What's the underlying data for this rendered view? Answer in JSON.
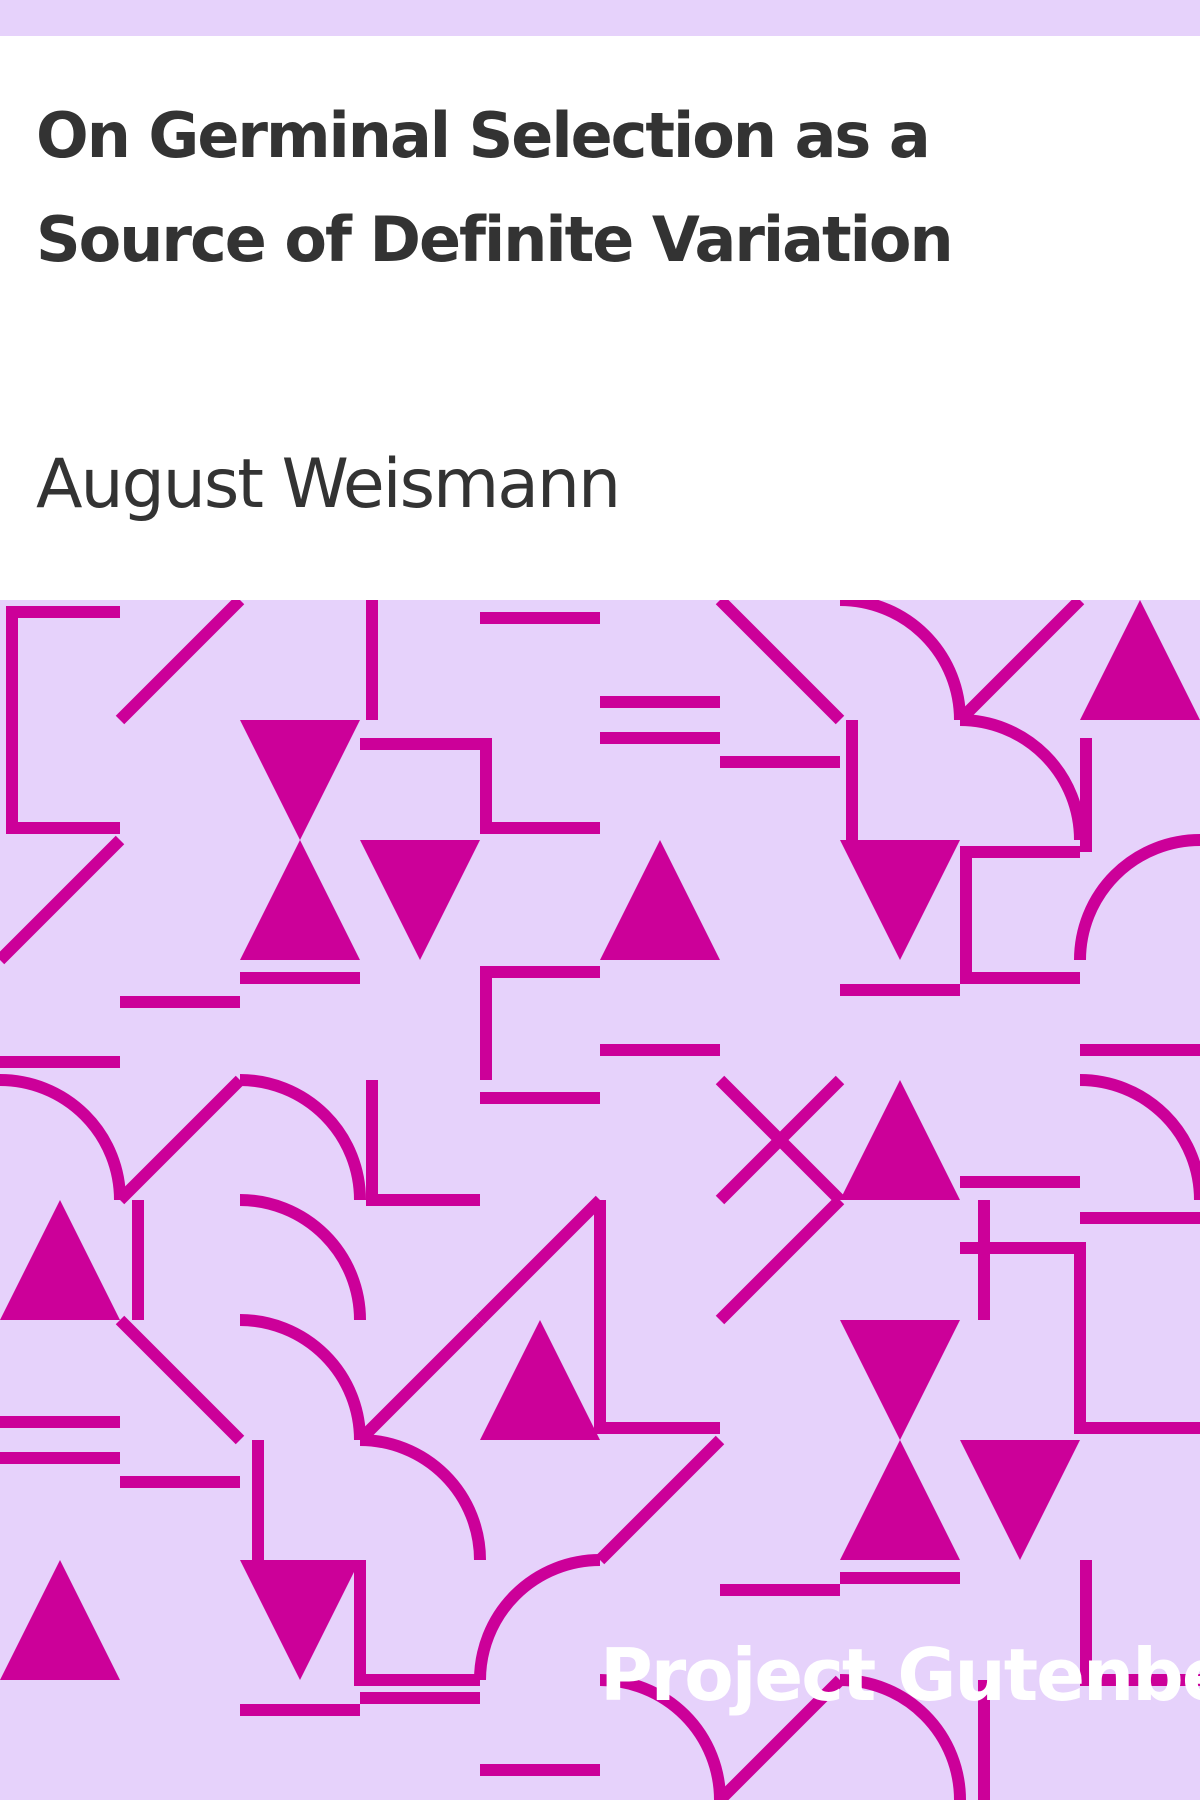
{
  "book": {
    "title": "On Germinal Selection as a Source of Definite Variation",
    "author": "August Weismann"
  },
  "publisher": "Project Gutenberg",
  "colors": {
    "background": "#e6d2fb",
    "pattern": "#cc0099",
    "panel": "#ffffff",
    "text": "#333333",
    "publisher_text": "#ffffff"
  }
}
